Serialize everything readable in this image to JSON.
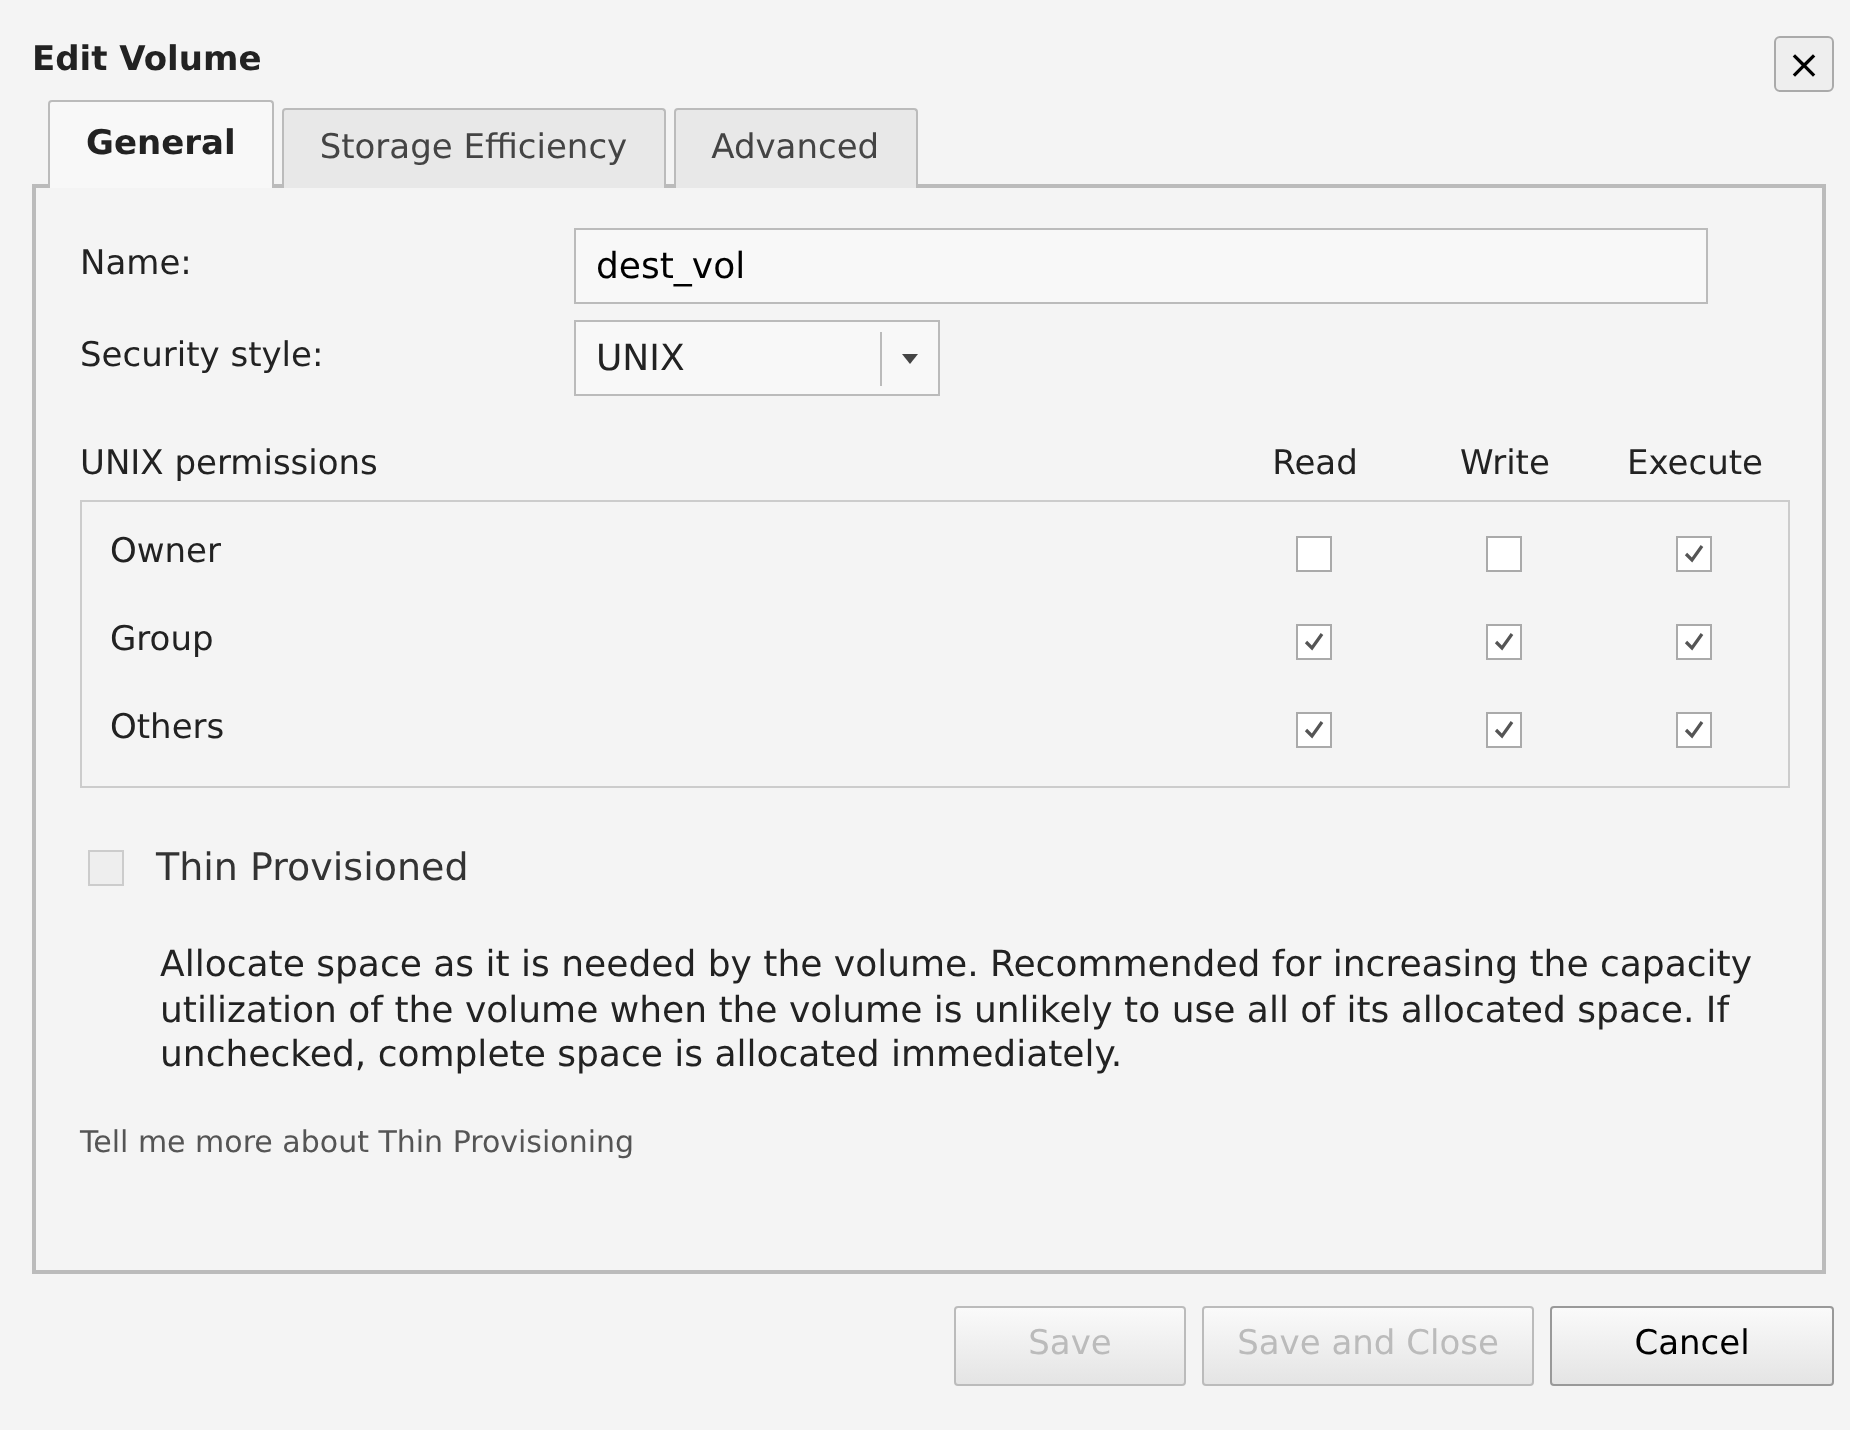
{
  "window": {
    "title": "Edit Volume",
    "close": "×"
  },
  "tabs": [
    {
      "label": "General",
      "selected": true
    },
    {
      "label": "Storage Efficiency",
      "selected": false
    },
    {
      "label": "Advanced",
      "selected": false
    }
  ],
  "name": {
    "label": "Name:",
    "value": "dest_vol"
  },
  "security_style": {
    "label": "Security style:",
    "value": "UNIX"
  },
  "permissions": {
    "title": "UNIX permissions",
    "columns": [
      "Read",
      "Write",
      "Execute"
    ],
    "rows": [
      {
        "label": "Owner",
        "checked": [
          false,
          false,
          true
        ]
      },
      {
        "label": "Group",
        "checked": [
          true,
          true,
          true
        ]
      },
      {
        "label": "Others",
        "checked": [
          true,
          true,
          true
        ]
      }
    ]
  },
  "thin_provisioned": {
    "label": "Thin Provisioned",
    "checked": false,
    "disabled": true,
    "description": "Allocate space as it is needed by the volume. Recommended for increasing the capacity utilization of the volume when the volume is unlikely to use all of its allocated space. If unchecked, complete space is allocated immediately."
  },
  "help_link": "Tell me more about Thin Provisioning",
  "buttons": [
    {
      "label": "Save",
      "disabled": true
    },
    {
      "label": "Save and Close",
      "disabled": true
    },
    {
      "label": "Cancel",
      "disabled": false
    }
  ]
}
